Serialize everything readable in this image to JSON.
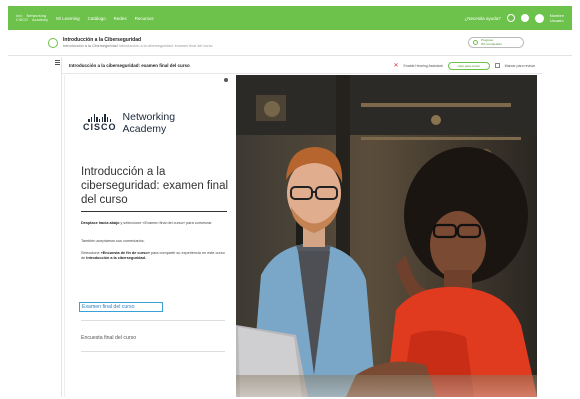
{
  "topbar": {
    "logo_line1a": "ılıılı",
    "logo_line1b": "Networking",
    "logo_line2a": "CISCO",
    "logo_line2b": "Academy",
    "nav": [
      "Mi Learning",
      "Catálogo",
      "Redes",
      "Recursos"
    ],
    "help": "¿Necesita ayuda?",
    "user_name": "Nombre",
    "user_sub": "Usuario"
  },
  "course": {
    "title": "Introducción a la Ciberseguridad",
    "breadcrumb_a": "Introducción a la Ciberseguridad",
    "breadcrumb_b": "Introducción a la ciberseguridad: examen final del curso",
    "progress_top": "Progreso",
    "progress_bottom": "0% completado"
  },
  "lesson": {
    "title": "Introducción a la ciberseguridad: examen final del curso",
    "disabled_label": "Enable Hearing Assistant",
    "button_label": "Listo para enviar",
    "checkbox_label": "Marcar para revisar"
  },
  "card": {
    "brand_cisco": "CISCO",
    "brand_networking": "Networking",
    "brand_academy": "Academy",
    "title": "Introducción a la ciberseguridad: examen final del curso",
    "p1_bold": "Desplace hacia abajo",
    "p1_rest": " y seleccione «Examen final del curso» para comenzar.",
    "p2": "También aceptamos sus comentarios.",
    "p3_pre": "Seleccione ",
    "p3_bold1": "«Encuesta de fin de curso»",
    "p3_mid": " para compartir su experiencia en este curso de ",
    "p3_bold2": "Introducción a la ciberseguridad.",
    "link_exam": "Examen final del curso",
    "link_survey": "Encuesta final del curso"
  },
  "colors": {
    "brand_green": "#6cc24a",
    "link_blue": "#2f7fc1",
    "focus_border": "#3aa0d8"
  },
  "icons": {
    "help": "question-icon",
    "settings": "gear-icon",
    "menu": "hamburger-icon",
    "close": "close-icon"
  }
}
